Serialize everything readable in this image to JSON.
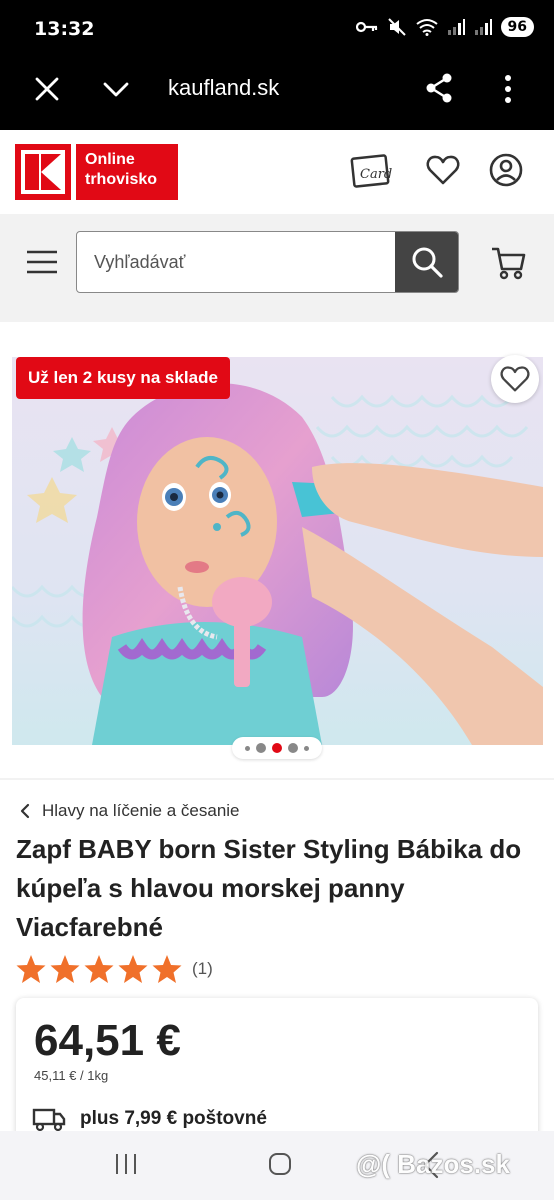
{
  "status_bar": {
    "time": "13:32",
    "battery": "96",
    "icons": [
      "key-icon",
      "mute-icon",
      "wifi-icon",
      "signal-icon",
      "signal-icon"
    ]
  },
  "browser": {
    "url": "kaufland.sk"
  },
  "header": {
    "logo_text": "Online trhovisko",
    "icons": [
      "card-icon",
      "heart-icon",
      "user-icon"
    ]
  },
  "search": {
    "placeholder": "Vyhľadávať"
  },
  "gallery": {
    "badge": "Už len 2 kusy na sklade",
    "dots_count": 5,
    "active_dot": 2
  },
  "product": {
    "breadcrumb": "Hlavy na líčenie a česanie",
    "title": "Zapf BABY born Sister Styling Bá­bika do kúpeľa s hlavou morskej panny Viacfarebné",
    "rating": 5,
    "rating_count": "(1)",
    "price": "64,51 €",
    "unit_price": "45,11 € / 1kg",
    "shipping": "plus 7,99 € poštovné"
  },
  "watermark": "@( Bazos.sk",
  "colors": {
    "brand": "#e10915",
    "star": "#f0702a"
  }
}
